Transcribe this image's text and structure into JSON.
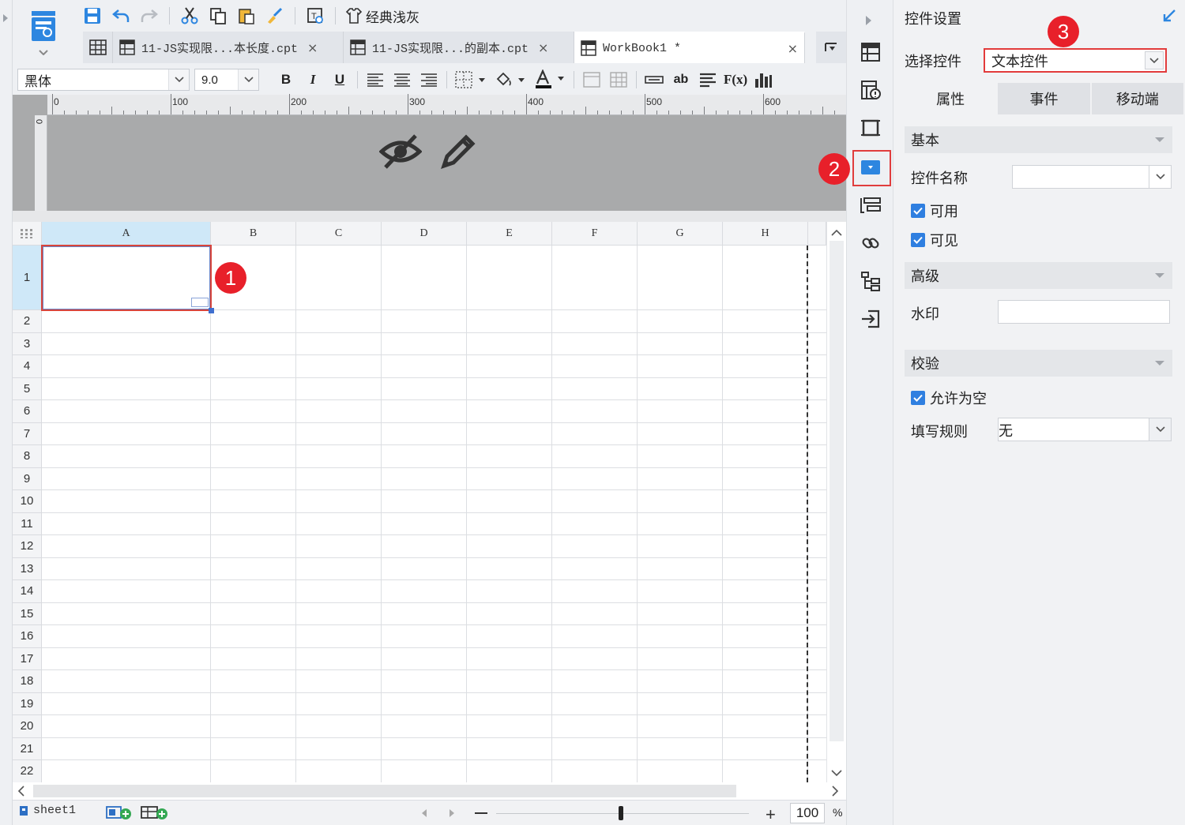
{
  "toolbar": {
    "theme_label": "经典浅灰"
  },
  "tabs": [
    {
      "label": "11-JS实现限...本长度.cpt",
      "close": "×"
    },
    {
      "label": "11-JS实现限...的副本.cpt",
      "close": "×"
    },
    {
      "label": "WorkBook1 *",
      "close": "×"
    }
  ],
  "format": {
    "font_family": "黑体",
    "font_size": "9.0",
    "bold": "B",
    "italic": "I",
    "underline": "U",
    "text_ab": "ab",
    "fx": "F(x)"
  },
  "ruler": {
    "marks": [
      "0",
      "100",
      "200",
      "300",
      "400",
      "500",
      "600"
    ],
    "vertical_zero": "0"
  },
  "grid": {
    "columns": [
      "A",
      "B",
      "C",
      "D",
      "E",
      "F",
      "G",
      "H"
    ],
    "rows": [
      "1",
      "2",
      "3",
      "4",
      "5",
      "6",
      "7",
      "8",
      "9",
      "10",
      "11",
      "12",
      "13",
      "14",
      "15",
      "16",
      "17",
      "18",
      "19",
      "20",
      "21",
      "22"
    ],
    "selected_cell": "A1"
  },
  "status": {
    "sheet_name": "sheet1",
    "zoom": "100",
    "zoom_unit": "%"
  },
  "panel": {
    "title": "控件设置",
    "select_label": "选择控件",
    "select_value": "文本控件",
    "tabs": [
      "属性",
      "事件",
      "移动端"
    ],
    "section_basic": "基本",
    "control_name_label": "控件名称",
    "enabled_label": "可用",
    "visible_label": "可见",
    "section_advanced": "高级",
    "watermark_label": "水印",
    "section_validation": "校验",
    "allow_empty_label": "允许为空",
    "fill_rule_label": "填写规则",
    "fill_rule_value": "无"
  },
  "badges": [
    "1",
    "2",
    "3"
  ],
  "colors": {
    "accent_blue": "#2f7fe0",
    "highlight_red": "#e23b3b",
    "badge_red": "#e8202a",
    "selected_header": "#cfe8f8"
  }
}
